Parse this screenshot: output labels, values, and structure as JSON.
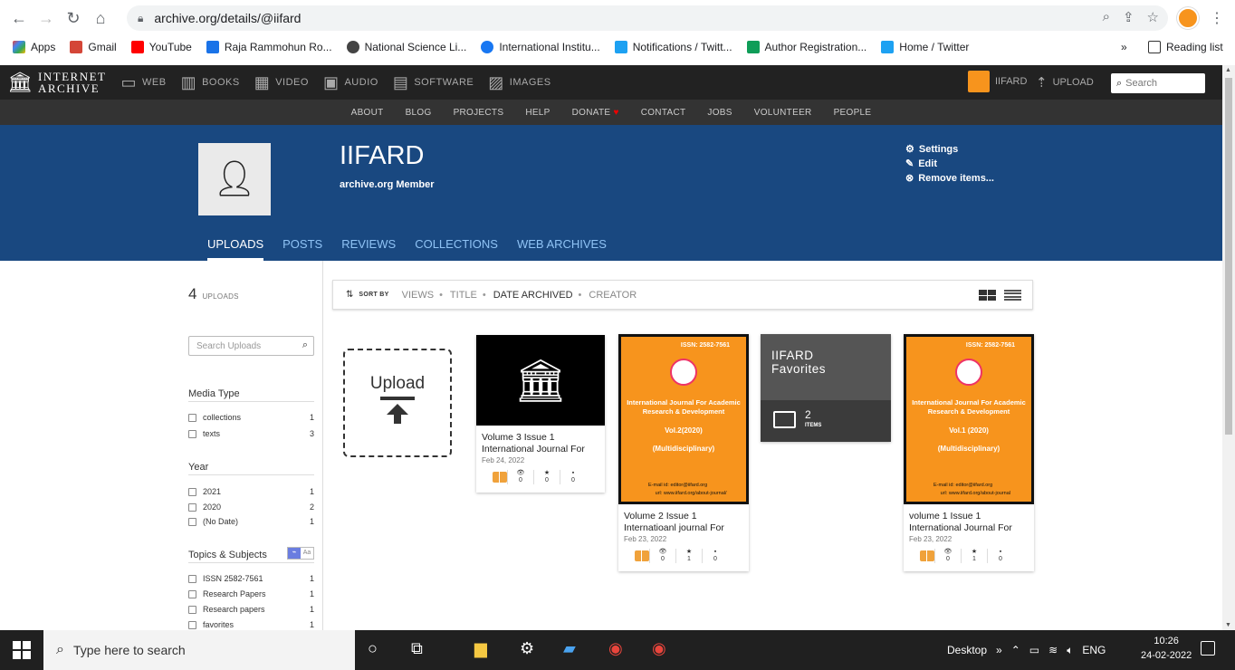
{
  "browser": {
    "url": "archive.org/details/@iifard",
    "bookmarks": [
      {
        "label": "Apps",
        "color": "#ea4335"
      },
      {
        "label": "Gmail",
        "color": "#d44638"
      },
      {
        "label": "YouTube",
        "color": "#ff0000"
      },
      {
        "label": "Raja Rammohun Ro...",
        "color": "#1a73e8"
      },
      {
        "label": "National Science Li...",
        "color": "#444444"
      },
      {
        "label": "International Institu...",
        "color": "#1877f2"
      },
      {
        "label": "Notifications / Twitt...",
        "color": "#1da1f2"
      },
      {
        "label": "Author Registration...",
        "color": "#0f9d58"
      },
      {
        "label": "Home / Twitter",
        "color": "#1da1f2"
      }
    ],
    "more": "»",
    "reading_list": "Reading list"
  },
  "ia_nav": {
    "logo_line1": "INTERNET",
    "logo_line2": "ARCHIVE",
    "media": [
      {
        "label": "WEB",
        "icon": "web-icon",
        "glyph": "▭"
      },
      {
        "label": "BOOKS",
        "icon": "books-icon",
        "glyph": "▥"
      },
      {
        "label": "VIDEO",
        "icon": "video-icon",
        "glyph": "▦"
      },
      {
        "label": "AUDIO",
        "icon": "audio-icon",
        "glyph": "▣"
      },
      {
        "label": "SOFTWARE",
        "icon": "software-icon",
        "glyph": "▤"
      },
      {
        "label": "IMAGES",
        "icon": "images-icon",
        "glyph": "▨"
      }
    ],
    "user": "IIFARD",
    "upload": "UPLOAD",
    "search_placeholder": "Search",
    "sub": [
      "ABOUT",
      "BLOG",
      "PROJECTS",
      "HELP",
      "DONATE",
      "CONTACT",
      "JOBS",
      "VOLUNTEER",
      "PEOPLE"
    ]
  },
  "profile": {
    "name": "IIFARD",
    "subtitle": "archive.org Member",
    "links": [
      "Settings",
      "Edit",
      "Remove items..."
    ],
    "tabs": [
      "UPLOADS",
      "POSTS",
      "REVIEWS",
      "COLLECTIONS",
      "WEB ARCHIVES"
    ]
  },
  "sidebar": {
    "count": "4",
    "count_label": "UPLOADS",
    "search_placeholder": "Search Uploads",
    "facets": {
      "media_type": {
        "title": "Media Type",
        "rows": [
          {
            "label": "collections",
            "count": "1"
          },
          {
            "label": "texts",
            "count": "3"
          }
        ]
      },
      "year": {
        "title": "Year",
        "rows": [
          {
            "label": "2021",
            "count": "1"
          },
          {
            "label": "2020",
            "count": "2"
          },
          {
            "label": "(No Date)",
            "count": "1"
          }
        ]
      },
      "topics": {
        "title": "Topics & Subjects",
        "rows": [
          {
            "label": "ISSN 2582-7561",
            "count": "1"
          },
          {
            "label": "Research Papers",
            "count": "1"
          },
          {
            "label": "Research papers",
            "count": "1"
          },
          {
            "label": "favorites",
            "count": "1"
          }
        ]
      }
    }
  },
  "sortbar": {
    "label": "SORT BY",
    "options": [
      "VIEWS",
      "TITLE",
      "DATE ARCHIVED",
      "CREATOR"
    ],
    "active": "DATE ARCHIVED"
  },
  "upload_tile": {
    "label": "Upload"
  },
  "items": [
    {
      "title1": "Volume 3 Issue 1",
      "title2": "International Journal For",
      "date": "Feb 24, 2022",
      "views": "0",
      "favs": "0",
      "reviews": "0"
    },
    {
      "title1": "Volume 2 Issue 1",
      "title2": "Internatioanl journal For",
      "date": "Feb 23, 2022",
      "views": "0",
      "favs": "1",
      "reviews": "0",
      "cover": {
        "issn": "ISSN:  2582-7561",
        "journal": "International Journal For Academic Research & Development",
        "vol": "Vol.2(2020)",
        "multi": "(Multidisciplinary)",
        "email_label": "E-mail id:",
        "email": "editor@iifard.org",
        "url_label": "url:",
        "url": "www.iifard.org/about-journal/"
      }
    },
    {
      "title1": "volume 1 Issue 1",
      "title2": "International Journal For",
      "date": "Feb 23, 2022",
      "views": "0",
      "favs": "1",
      "reviews": "0",
      "cover": {
        "issn": "ISSN:  2582-7561",
        "journal": "International Journal For Academic Research & Development",
        "vol": "Vol.1 (2020)",
        "multi": "(Multidisciplinary)",
        "email_label": "E-mail id:",
        "email": "editor@iifard.org",
        "url_label": "url:",
        "url": "www.iifard.org/about-journal"
      }
    }
  ],
  "collection_tile": {
    "title1": "IIFARD",
    "title2": "Favorites",
    "count": "2",
    "count_label": "ITEMS"
  },
  "taskbar": {
    "search_placeholder": "Type here to search",
    "desktop": "Desktop",
    "more": "»",
    "lang": "ENG",
    "time": "10:26",
    "date": "24-02-2022"
  }
}
